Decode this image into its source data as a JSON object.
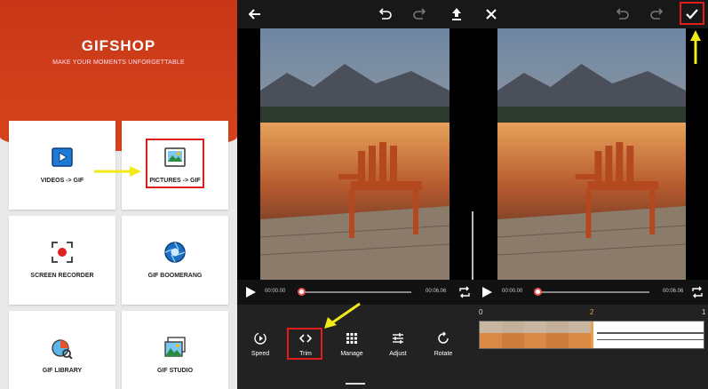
{
  "home": {
    "app_title": "GIFSHOP",
    "tagline": "MAKE YOUR MOMENTS UNFORGETTABLE",
    "cards": [
      {
        "label": "VIDEOS -> GIF",
        "icon": "video-play-icon"
      },
      {
        "label": "PICTURES -> GIF",
        "icon": "picture-icon"
      },
      {
        "label": "SCREEN RECORDER",
        "icon": "screen-record-icon"
      },
      {
        "label": "GIF BOOMERANG",
        "icon": "aperture-icon"
      },
      {
        "label": "GIF LIBRARY",
        "icon": "library-icon"
      },
      {
        "label": "GIF STUDIO",
        "icon": "studio-icon"
      }
    ],
    "accent": "#d23d1a"
  },
  "editor": {
    "time_start": "00:00.00",
    "time_end": "00:06.06",
    "progress": 0.0,
    "tools": [
      {
        "label": "Speed",
        "icon": "speed-icon"
      },
      {
        "label": "Trim",
        "icon": "trim-icon"
      },
      {
        "label": "Manage",
        "icon": "grid-icon"
      },
      {
        "label": "Adjust",
        "icon": "sliders-icon"
      },
      {
        "label": "Rotate",
        "icon": "rotate-icon"
      }
    ]
  },
  "trim": {
    "time_start": "00:00.00",
    "time_end": "00:06.06",
    "timeline_marks": [
      "0",
      "2",
      "1"
    ]
  },
  "highlight_color": "#e01c1c",
  "arrow_color": "#f2e91a"
}
